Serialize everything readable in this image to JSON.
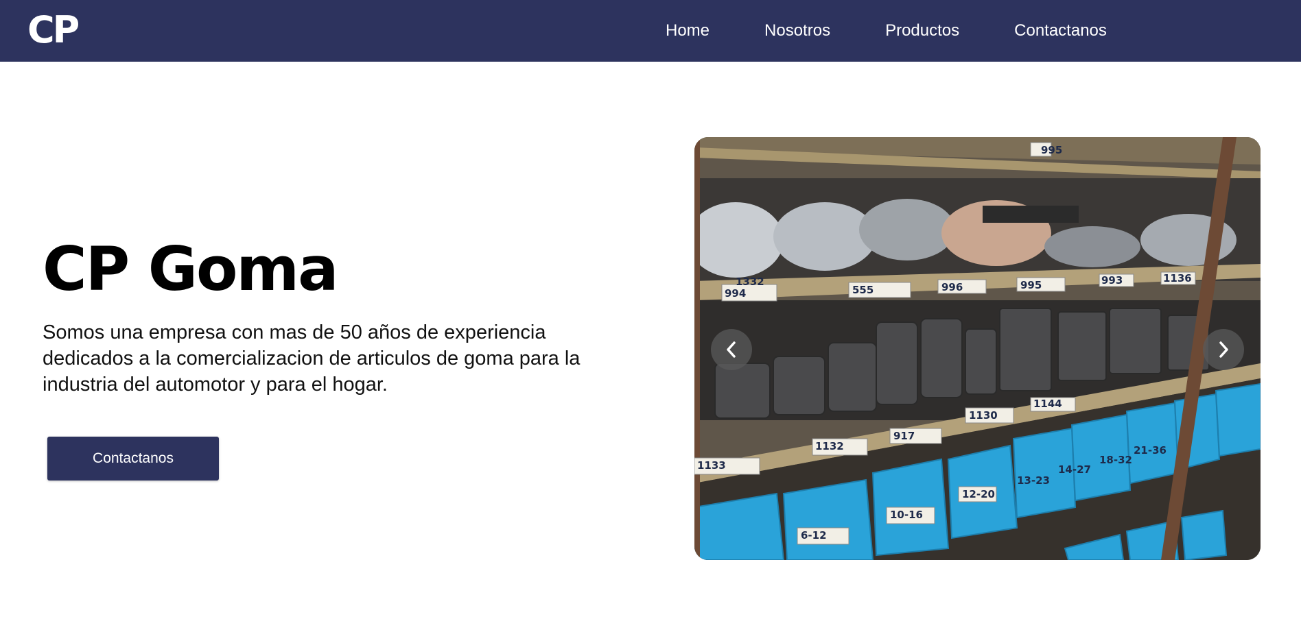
{
  "brand": {
    "logo_text": "CP"
  },
  "nav": {
    "items": [
      {
        "label": "Home"
      },
      {
        "label": "Nosotros"
      },
      {
        "label": "Productos"
      },
      {
        "label": "Contactanos"
      }
    ]
  },
  "hero": {
    "title": "CP Goma",
    "description": "Somos una empresa con mas de 50 años de experiencia dedicados a la comercializacion de articulos de goma para la industria del automotor y para el hogar.",
    "cta_label": "Contactanos"
  },
  "carousel": {
    "prev_icon": "chevron-left-icon",
    "next_icon": "chevron-right-icon",
    "shelf_labels": [
      "1332",
      "995",
      "994",
      "555",
      "996",
      "995",
      "993",
      "1136",
      "1132",
      "917",
      "1130",
      "1144",
      "1133",
      "6-12",
      "10-16",
      "12-20",
      "13-23",
      "14-27",
      "18-32",
      "21-36"
    ]
  },
  "colors": {
    "brand_navy": "#2d335e",
    "text": "#000000",
    "bin_blue": "#2aa3d9"
  }
}
